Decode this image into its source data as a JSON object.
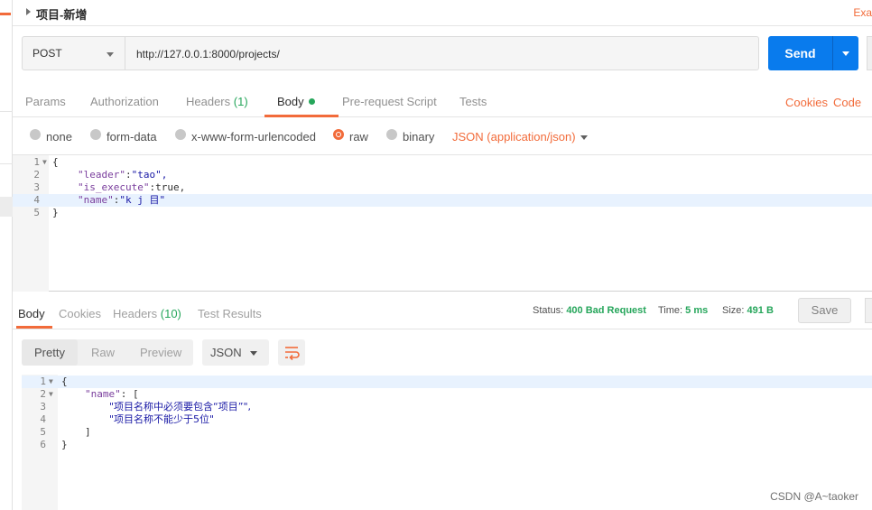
{
  "title": "项目-新增",
  "title_right": "Exa",
  "request": {
    "method": "POST",
    "url": "http://127.0.0.1:8000/projects/",
    "send_label": "Send"
  },
  "request_tabs": {
    "params": "Params",
    "authorization": "Authorization",
    "headers": "Headers",
    "headers_count": "(1)",
    "body": "Body",
    "prerequest": "Pre-request Script",
    "tests": "Tests",
    "cookies": "Cookies",
    "code": "Code"
  },
  "body_options": {
    "none": "none",
    "form_data": "form-data",
    "urlencoded": "x-www-form-urlencoded",
    "raw": "raw",
    "binary": "binary",
    "content_type": "JSON (application/json)",
    "selected": "raw"
  },
  "request_body": {
    "line_numbers": [
      "1",
      "2",
      "3",
      "4",
      "5"
    ],
    "open_brace": "{",
    "leader_key": "\"leader\"",
    "leader_val": "\"tao\",",
    "exec_key": "\"is_execute\"",
    "exec_val": "true,",
    "name_key": "\"name\"",
    "name_val": "\"k j 目\"",
    "close_brace": "}"
  },
  "response_tabs": {
    "body": "Body",
    "cookies": "Cookies",
    "headers": "Headers",
    "headers_count": "(10)",
    "test_results": "Test Results"
  },
  "response_status": {
    "status_label": "Status:",
    "status_value": "400 Bad Request",
    "time_label": "Time:",
    "time_value": "5 ms",
    "size_label": "Size:",
    "size_value": "491 B",
    "save_label": "Save"
  },
  "view_modes": {
    "pretty": "Pretty",
    "raw": "Raw",
    "preview": "Preview",
    "format": "JSON"
  },
  "response_body": {
    "line_numbers": [
      "1",
      "2",
      "3",
      "4",
      "5",
      "6"
    ],
    "open_brace": "{",
    "name_key": "\"name\"",
    "open_bracket": "[",
    "msg1": "\"项目名称中必须要包含“项目”\",",
    "msg2": "\"项目名称不能少于5位\"",
    "close_bracket": "]",
    "close_brace": "}"
  },
  "watermark": "CSDN @A~taoker",
  "colors": {
    "accent": "#f26b3a",
    "send": "#097bed",
    "success_green": "#26a65b"
  }
}
